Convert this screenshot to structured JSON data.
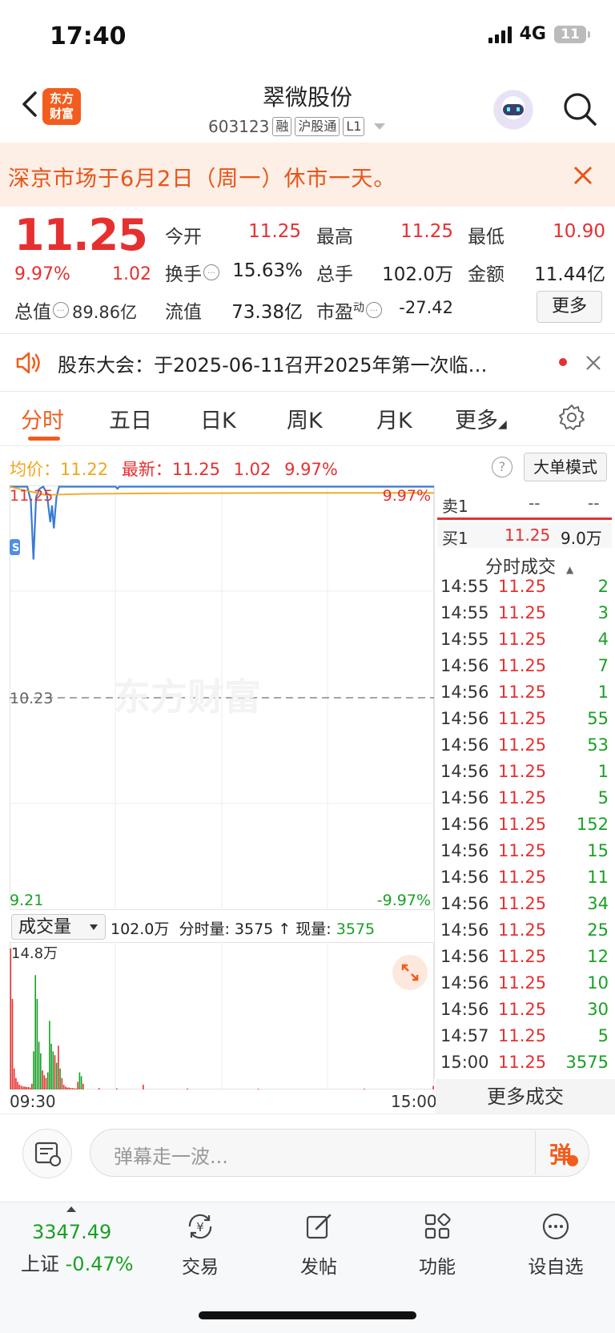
{
  "status_bar": {
    "time": "17:40",
    "network": "4G",
    "battery": "11"
  },
  "header": {
    "logo_line1": "东方",
    "logo_line2": "财富",
    "stock_name": "翠微股份",
    "stock_code": "603123",
    "tags": [
      "融",
      "沪股通",
      "L1"
    ]
  },
  "notice": {
    "text": "深京市场于6月2日（周一）休市一天。"
  },
  "quote": {
    "price": "11.25",
    "change_pct": "9.97%",
    "change_amt": "1.02",
    "total_cap_label": "总值",
    "total_cap_value": "89.86亿",
    "fields": [
      {
        "label": "今开",
        "value": "11.25",
        "color": "#e63030"
      },
      {
        "label": "最高",
        "value": "11.25",
        "color": "#e63030"
      },
      {
        "label": "最低",
        "value": "10.90",
        "color": "#e63030"
      },
      {
        "label": "换手",
        "value": "15.63%",
        "color": "#222222"
      },
      {
        "label": "总手",
        "value": "102.0万",
        "color": "#222222"
      },
      {
        "label": "金额",
        "value": "11.44亿",
        "color": "#222222"
      },
      {
        "label": "流值",
        "value": "73.38亿",
        "color": "#222222"
      },
      {
        "label": "市盈",
        "value": "-27.42",
        "color": "#222222"
      }
    ],
    "pe_superscript": "动",
    "more_label": "更多"
  },
  "announcement": {
    "text": "股东大会：于2025-06-11召开2025年第一次临…"
  },
  "tabs": [
    "分时",
    "五日",
    "日K",
    "周K",
    "月K",
    "更多"
  ],
  "chart_stats": {
    "avg_label": "均价：",
    "avg_value": "11.22",
    "latest_label": "最新：",
    "latest_value": "11.25",
    "latest_change": "1.02",
    "latest_pct": "9.97%",
    "help": "?",
    "big_order_mode": "大单模式"
  },
  "chart_data": {
    "type": "line",
    "x_start_label": "09:30",
    "x_end_label": "15:00",
    "y_max_label": "11.25",
    "y_mid_label": "10.23",
    "y_min_label": "9.21",
    "pct_max_label": "9.97%",
    "pct_min_label": "-9.97%",
    "ylim": [
      9.21,
      11.25
    ],
    "prev_close": 10.23,
    "x": [
      0,
      4,
      8,
      10,
      12,
      14,
      17,
      20,
      22,
      24,
      26,
      28,
      30,
      35,
      60,
      120,
      240
    ],
    "price": [
      11.25,
      11.25,
      11.25,
      11.25,
      11.25,
      11.25,
      11.25,
      11.25,
      11.25,
      11.25,
      11.25,
      11.25,
      11.25,
      11.25,
      11.25,
      11.25,
      11.25
    ],
    "series": [
      {
        "name": "价格",
        "color": "#3a7bd5",
        "points": [
          [
            0,
            11.25
          ],
          [
            10,
            11.25
          ],
          [
            12,
            11.18
          ],
          [
            13.5,
            10.9
          ],
          [
            15,
            11.2
          ],
          [
            17,
            11.24
          ],
          [
            19,
            11.25
          ],
          [
            21,
            11.22
          ],
          [
            23,
            11.08
          ],
          [
            24,
            11.16
          ],
          [
            25,
            11.05
          ],
          [
            26.5,
            11.2
          ],
          [
            28,
            11.25
          ],
          [
            60,
            11.25
          ],
          [
            61,
            11.24
          ],
          [
            62,
            11.25
          ],
          [
            240,
            11.25
          ]
        ]
      },
      {
        "name": "均价",
        "color": "#f2a51c",
        "points": [
          [
            0,
            11.25
          ],
          [
            10,
            11.23
          ],
          [
            20,
            11.21
          ],
          [
            40,
            11.215
          ],
          [
            80,
            11.218
          ],
          [
            160,
            11.22
          ],
          [
            240,
            11.22
          ]
        ]
      }
    ],
    "volume": {
      "label": "成交量",
      "max_label": "14.8万",
      "max": 148000,
      "bars": [
        [
          0,
          148000,
          "red"
        ],
        [
          1,
          95000,
          "red"
        ],
        [
          2,
          22000,
          "red"
        ],
        [
          3,
          12000,
          "red"
        ],
        [
          4,
          8000,
          "red"
        ],
        [
          5,
          5000,
          "red"
        ],
        [
          6,
          4000,
          "red"
        ],
        [
          7,
          3000,
          "red"
        ],
        [
          8,
          3000,
          "red"
        ],
        [
          9,
          2500,
          "red"
        ],
        [
          10,
          2500,
          "red"
        ],
        [
          11,
          2000,
          "red"
        ],
        [
          12,
          6000,
          "red"
        ],
        [
          13,
          40000,
          "green"
        ],
        [
          14,
          120000,
          "green"
        ],
        [
          15,
          95000,
          "green"
        ],
        [
          16,
          50000,
          "green"
        ],
        [
          17,
          38000,
          "green"
        ],
        [
          18,
          20000,
          "red"
        ],
        [
          19,
          15000,
          "red"
        ],
        [
          20,
          12000,
          "red"
        ],
        [
          21,
          18000,
          "green"
        ],
        [
          22,
          72000,
          "green"
        ],
        [
          23,
          48000,
          "green"
        ],
        [
          24,
          40000,
          "green"
        ],
        [
          25,
          36000,
          "red"
        ],
        [
          26,
          28000,
          "green"
        ],
        [
          27,
          46000,
          "red"
        ],
        [
          28,
          22000,
          "green"
        ],
        [
          29,
          12000,
          "red"
        ],
        [
          30,
          5000,
          "red"
        ],
        [
          31,
          3000,
          "red"
        ],
        [
          32,
          2000,
          "red"
        ],
        [
          33,
          2000,
          "red"
        ],
        [
          34,
          1500,
          "red"
        ],
        [
          35,
          1500,
          "red"
        ],
        [
          36,
          1200,
          "red"
        ],
        [
          37,
          1000,
          "red"
        ],
        [
          38,
          8000,
          "red"
        ],
        [
          39,
          18000,
          "green"
        ],
        [
          40,
          14000,
          "green"
        ],
        [
          41,
          6000,
          "red"
        ],
        [
          50,
          1500,
          "red"
        ],
        [
          60,
          1200,
          "red"
        ],
        [
          75,
          5000,
          "red"
        ],
        [
          100,
          1000,
          "red"
        ],
        [
          140,
          800,
          "red"
        ],
        [
          200,
          800,
          "red"
        ],
        [
          239,
          3575,
          "red"
        ]
      ]
    }
  },
  "volume_bar": {
    "selector_label": "成交量",
    "total": "102.0万",
    "minute_label": "分时量:",
    "minute_value": "3575",
    "arrow": "↑",
    "now_label": "现量:",
    "now_value": "3575"
  },
  "order_book": {
    "sell1_label": "卖1",
    "sell1_price": "--",
    "sell1_qty": "--",
    "buy1_label": "买1",
    "buy1_price": "11.25",
    "buy1_qty": "9.0万"
  },
  "trades": {
    "title": "分时成交",
    "rows": [
      {
        "time": "14:55",
        "price": "11.25",
        "qty": "2"
      },
      {
        "time": "14:55",
        "price": "11.25",
        "qty": "3"
      },
      {
        "time": "14:55",
        "price": "11.25",
        "qty": "4"
      },
      {
        "time": "14:56",
        "price": "11.25",
        "qty": "7"
      },
      {
        "time": "14:56",
        "price": "11.25",
        "qty": "1"
      },
      {
        "time": "14:56",
        "price": "11.25",
        "qty": "55"
      },
      {
        "time": "14:56",
        "price": "11.25",
        "qty": "53"
      },
      {
        "time": "14:56",
        "price": "11.25",
        "qty": "1"
      },
      {
        "time": "14:56",
        "price": "11.25",
        "qty": "5"
      },
      {
        "time": "14:56",
        "price": "11.25",
        "qty": "152"
      },
      {
        "time": "14:56",
        "price": "11.25",
        "qty": "15"
      },
      {
        "time": "14:56",
        "price": "11.25",
        "qty": "11"
      },
      {
        "time": "14:56",
        "price": "11.25",
        "qty": "34"
      },
      {
        "time": "14:56",
        "price": "11.25",
        "qty": "25"
      },
      {
        "time": "14:56",
        "price": "11.25",
        "qty": "12"
      },
      {
        "time": "14:56",
        "price": "11.25",
        "qty": "10"
      },
      {
        "time": "14:56",
        "price": "11.25",
        "qty": "30"
      },
      {
        "time": "14:57",
        "price": "11.25",
        "qty": "5"
      },
      {
        "time": "15:00",
        "price": "11.25",
        "qty": "3575"
      }
    ],
    "more_label": "更多成交"
  },
  "danmu": {
    "placeholder": "弹幕走一波...",
    "button": "弹"
  },
  "bottom_nav": {
    "index_value": "3347.49",
    "index_name": "上证",
    "index_change": "-0.47%",
    "items": [
      {
        "label": "交易",
        "icon": "yuan-exchange-icon"
      },
      {
        "label": "发帖",
        "icon": "edit-post-icon"
      },
      {
        "label": "功能",
        "icon": "grid-function-icon"
      },
      {
        "label": "设自选",
        "icon": "more-dots-icon"
      }
    ]
  }
}
